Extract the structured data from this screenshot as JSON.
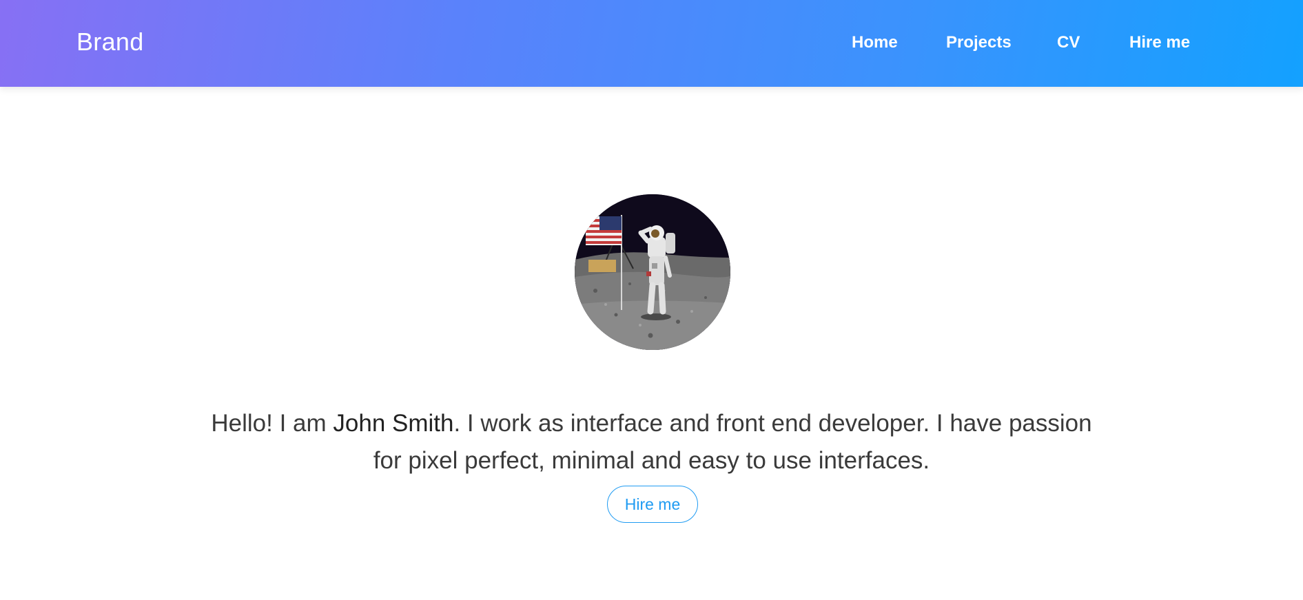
{
  "navbar": {
    "brand": "Brand",
    "gradient_start": "#8770f4",
    "gradient_end": "#13a1ff",
    "links": [
      {
        "label": "Home"
      },
      {
        "label": "Projects"
      },
      {
        "label": "CV"
      },
      {
        "label": "Hire me"
      }
    ]
  },
  "hero": {
    "avatar_description_icon": "astronaut-photo",
    "intro_prefix": "Hello! I am ",
    "name": "John Smith",
    "intro_suffix": ". I work as interface and front end developer. I have passion for pixel perfect, minimal and easy to use interfaces.",
    "button_label": "Hire me",
    "button_color": "#1f9bf2"
  }
}
